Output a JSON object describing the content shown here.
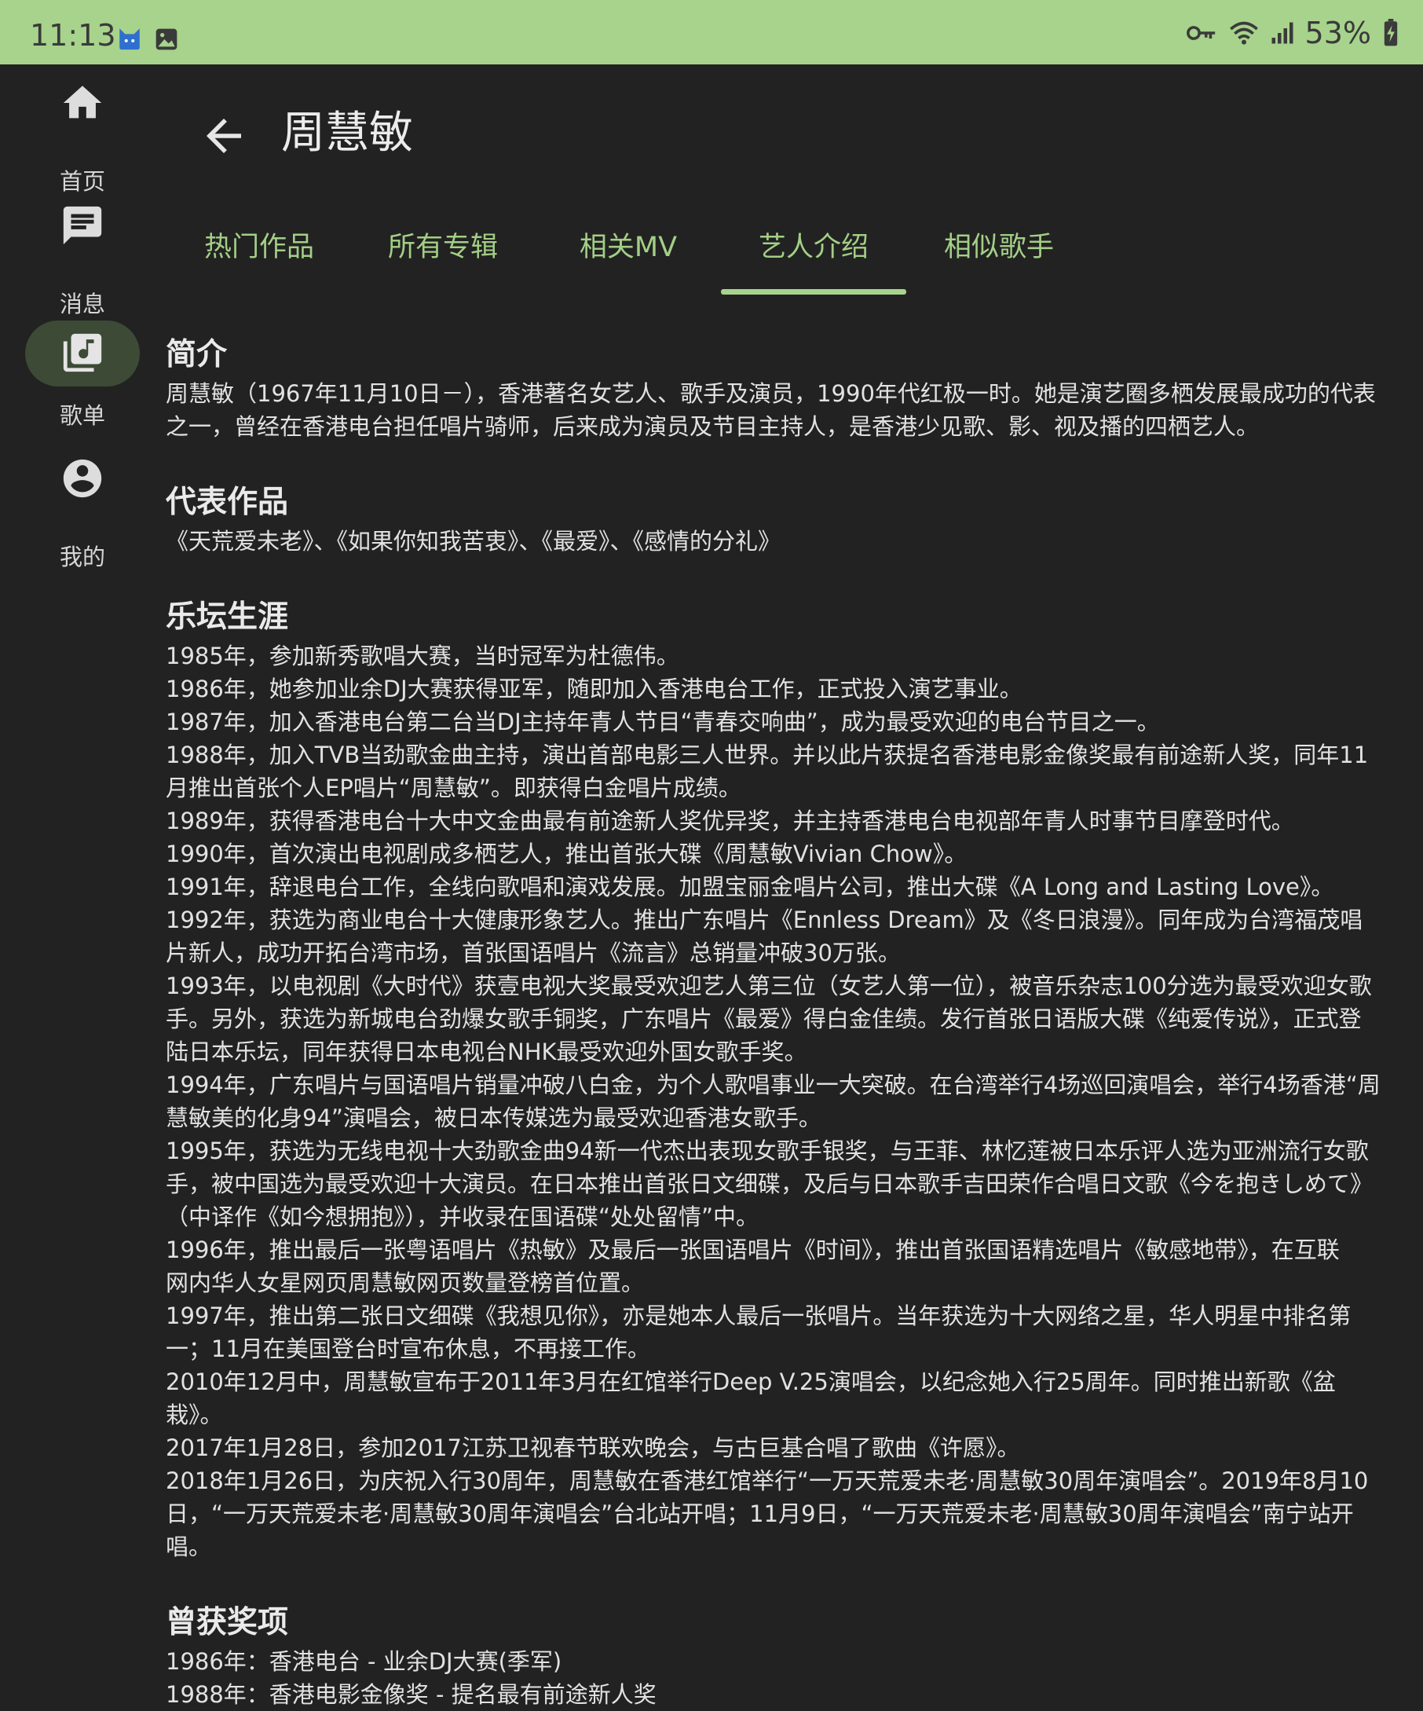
{
  "status_bar": {
    "time": "11:13",
    "battery": "53%",
    "icons": [
      "cat-icon",
      "image-icon",
      "vpn-key-icon",
      "wifi-icon",
      "signal-icon",
      "battery-charging-icon"
    ]
  },
  "nav": {
    "items": [
      {
        "label": "首页",
        "icon": "home-icon",
        "active": false
      },
      {
        "label": "消息",
        "icon": "message-icon",
        "active": false
      },
      {
        "label": "歌单",
        "icon": "music-library-icon",
        "active": true
      },
      {
        "label": "我的",
        "icon": "account-icon",
        "active": false
      }
    ]
  },
  "header": {
    "title": "周慧敏"
  },
  "tabs": [
    {
      "label": "热门作品",
      "active": false
    },
    {
      "label": "所有专辑",
      "active": false
    },
    {
      "label": "相关MV",
      "active": false
    },
    {
      "label": "艺人介绍",
      "active": true
    },
    {
      "label": "相似歌手",
      "active": false
    }
  ],
  "colors": {
    "accent": "#a7d38c",
    "tab_text": "#a3cf86",
    "background": "#222222",
    "active_pill": "#3c4a36"
  },
  "sections": {
    "intro": {
      "title": "简介",
      "lines": [
        "周慧敏（1967年11月10日－），香港著名女艺人、歌手及演员，1990年代红极一时。她是演艺圈多栖发展最成功的代表",
        "之一，曾经在香港电台担任唱片骑师，后来成为演员及节目主持人，是香港少见歌、影、视及播的四栖艺人。"
      ]
    },
    "works": {
      "title": "代表作品",
      "lines": [
        "《天荒爱未老》、《如果你知我苦衷》、《最爱》、《感情的分礼》"
      ]
    },
    "career": {
      "title": "乐坛生涯",
      "lines": [
        "1985年，参加新秀歌唱大赛，当时冠军为杜德伟。",
        "1986年，她参加业余DJ大赛获得亚军，随即加入香港电台工作，正式投入演艺事业。",
        "1987年，加入香港电台第二台当DJ主持年青人节目“青春交响曲”，成为最受欢迎的电台节目之一。",
        "1988年，加入TVB当劲歌金曲主持，演出首部电影三人世界。并以此片获提名香港电影金像奖最有前途新人奖，同年11",
        "月推出首张个人EP唱片“周慧敏”。即获得白金唱片成绩。",
        "1989年，获得香港电台十大中文金曲最有前途新人奖优异奖，并主持香港电台电视部年青人时事节目摩登时代。",
        "1990年，首次演出电视剧成多栖艺人，推出首张大碟《周慧敏Vivian Chow》。",
        "1991年，辞退电台工作，全线向歌唱和演戏发展。加盟宝丽金唱片公司，推出大碟《A Long and Lasting Love》。",
        "1992年，获选为商业电台十大健康形象艺人。推出广东唱片《Ennless Dream》及《冬日浪漫》。同年成为台湾福茂唱",
        "片新人，成功开拓台湾市场，首张国语唱片《流言》总销量冲破30万张。",
        "1993年，以电视剧《大时代》获壹电视大奖最受欢迎艺人第三位（女艺人第一位），被音乐杂志100分选为最受欢迎女歌",
        "手。另外，获选为新城电台劲爆女歌手铜奖，广东唱片《最爱》得白金佳绩。发行首张日语版大碟《纯爱传说》，正式登",
        "陆日本乐坛，同年获得日本电视台NHK最受欢迎外国女歌手奖。",
        "1994年，广东唱片与国语唱片销量冲破八白金，为个人歌唱事业一大突破。在台湾举行4场巡回演唱会，举行4场香港“周",
        "慧敏美的化身94”演唱会，被日本传媒选为最受欢迎香港女歌手。",
        "1995年，获选为无线电视十大劲歌金曲94新一代杰出表现女歌手银奖，与王菲、林忆莲被日本乐评人选为亚洲流行女歌",
        "手，被中国选为最受欢迎十大演员。在日本推出首张日文细碟，及后与日本歌手吉田荣作合唱日文歌《今を抱きしめて》",
        "（中译作《如今想拥抱》），并收录在国语碟“处处留情”中。",
        "1996年，推出最后一张粤语唱片《热敏》及最后一张国语唱片《时间》，推出首张国语精选唱片《敏感地带》，在互联",
        "网内华人女星网页周慧敏网页数量登榜首位置。",
        "1997年，推出第二张日文细碟《我想见你》，亦是她本人最后一张唱片。当年获选为十大网络之星，华人明星中排名第",
        "一；11月在美国登台时宣布休息，不再接工作。",
        "2010年12月中，周慧敏宣布于2011年3月在红馆举行Deep V.25演唱会，以纪念她入行25周年。同时推出新歌《盆",
        "栽》。",
        "2017年1月28日，参加2017江苏卫视春节联欢晚会，与古巨基合唱了歌曲《许愿》。",
        "2018年1月26日，为庆祝入行30周年，周慧敏在香港红馆举行“一万天荒爱未老·周慧敏30周年演唱会”。2019年8月10",
        "日，“一万天荒爱未老·周慧敏30周年演唱会”台北站开唱；11月9日，“一万天荒爱未老·周慧敏30周年演唱会”南宁站开",
        "唱。"
      ]
    },
    "awards": {
      "title": "曾获奖项",
      "lines": [
        "1986年：香港电台 - 业余DJ大赛(季军)",
        "1988年：香港电影金像奖 - 提名最有前途新人奖"
      ]
    }
  }
}
